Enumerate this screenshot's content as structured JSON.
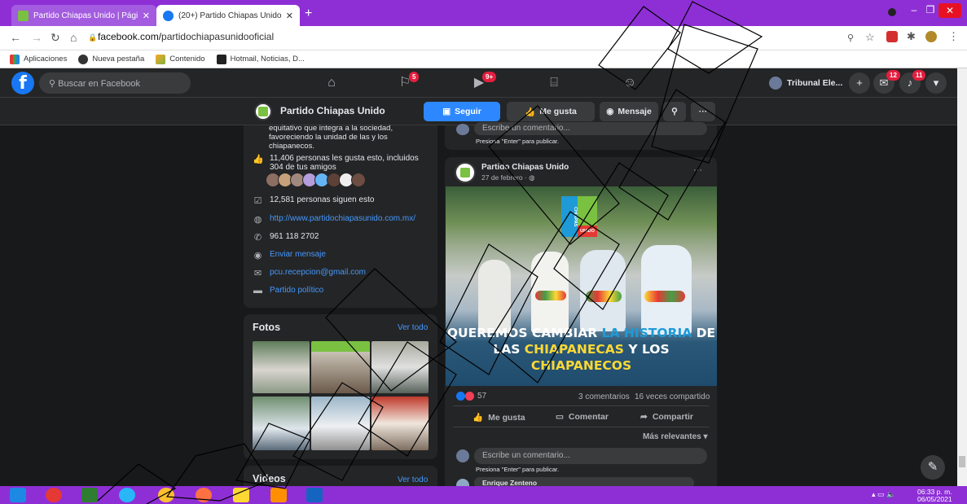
{
  "browser": {
    "tabs": [
      {
        "title": "Partido Chiapas Unido | Página oficial"
      },
      {
        "title": "(20+) Partido Chiapas Unido | Facebook"
      }
    ],
    "new_tab": "+",
    "url_prefix": "facebook.com/",
    "url_path": "partidochiapasunidooficial",
    "bookmarks": [
      "Aplicaciones",
      "Nueva pestaña",
      "Contenido",
      "Hotmail, Noticias, D..."
    ]
  },
  "fb": {
    "search_placeholder": "Buscar en Facebook",
    "badges": {
      "pages": "5",
      "watch": "9+",
      "messenger": "12",
      "notifications": "11"
    },
    "account_name": "Tribunal Ele..."
  },
  "page": {
    "name": "Partido Chiapas Unido",
    "follow_label": "Seguir",
    "like_label": "Me gusta",
    "message_label": "Mensaje",
    "more_label": "···"
  },
  "about": {
    "description_tail": "equitativo que integra a la sociedad, favoreciendo la unidad de las y los chiapanecos.",
    "likes_text": "11,406 personas les gusta esto, incluidos 304 de tus amigos",
    "followers_text": "12,581 personas siguen esto",
    "website": "http://www.partidochiapasunido.com.mx/",
    "phone": "961 118 2702",
    "send_message": "Enviar mensaje",
    "email": "pcu.recepcion@gmail.com",
    "category": "Partido político"
  },
  "photos": {
    "title": "Fotos",
    "see_all": "Ver todo"
  },
  "videos": {
    "title": "Videos",
    "see_all": "Ver todo"
  },
  "comment": {
    "placeholder": "Escribe un comentario...",
    "hint": "Presiona \"Enter\" para publicar."
  },
  "post": {
    "author": "Partido Chiapas Unido",
    "date": "27 de febrero · ",
    "menu": "···",
    "banner_logo_top": "CHIAPAS",
    "banner_logo_bottom": "UNIDO",
    "banner_line1_a": "QUEREMOS CAMBIAR ",
    "banner_line1_b": "LA HISTORIA",
    "banner_line1_c": " DE",
    "banner_line2_a": "LAS ",
    "banner_line2_b": "CHIAPANECAS",
    "banner_line2_c": " Y LOS",
    "banner_line3": "CHIAPANECOS",
    "reactions_count": "57",
    "comments_count": "3 comentarios",
    "shares_count": "16 veces compartido",
    "like_action": "Me gusta",
    "comment_action": "Comentar",
    "share_action": "Compartir",
    "sort_label": "Más relevantes",
    "first_commenter": "Enrique Zenteno"
  },
  "taskbar": {
    "time": "06:33 p. m.",
    "date": "06/05/2021"
  },
  "colors": {
    "fb_blue": "#1877f2",
    "follow_blue": "#2d88ff",
    "chrome_purple": "#8e2fd6",
    "dark_bg": "#18191a",
    "card_bg": "#242526",
    "green_brand": "#7ac142"
  }
}
